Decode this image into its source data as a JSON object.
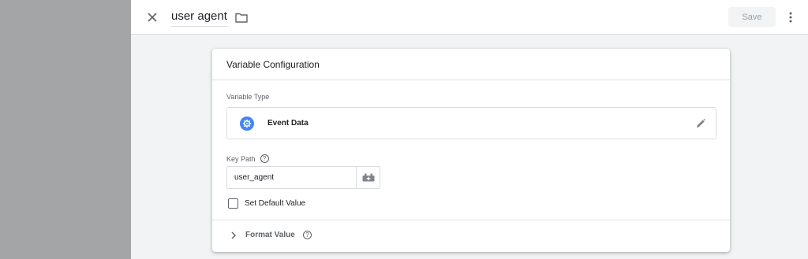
{
  "header": {
    "title": "user agent",
    "save_label": "Save",
    "icons": {
      "close": "close-icon",
      "folder": "folder-icon",
      "more": "more-vertical-icon"
    }
  },
  "card": {
    "title": "Variable Configuration",
    "variable_type_label": "Variable Type",
    "variable_type": {
      "name": "Event Data",
      "icon": "gear-icon",
      "icon_color": "#4285f4"
    },
    "key_path": {
      "label": "Key Path",
      "value": "user_agent"
    },
    "default_value_label": "Set Default Value",
    "default_value_checked": false,
    "format_value_label": "Format Value"
  },
  "colors": {
    "backdrop": "#a4a5a7",
    "panel": "#f1f3f4",
    "accent": "#4285f4"
  }
}
